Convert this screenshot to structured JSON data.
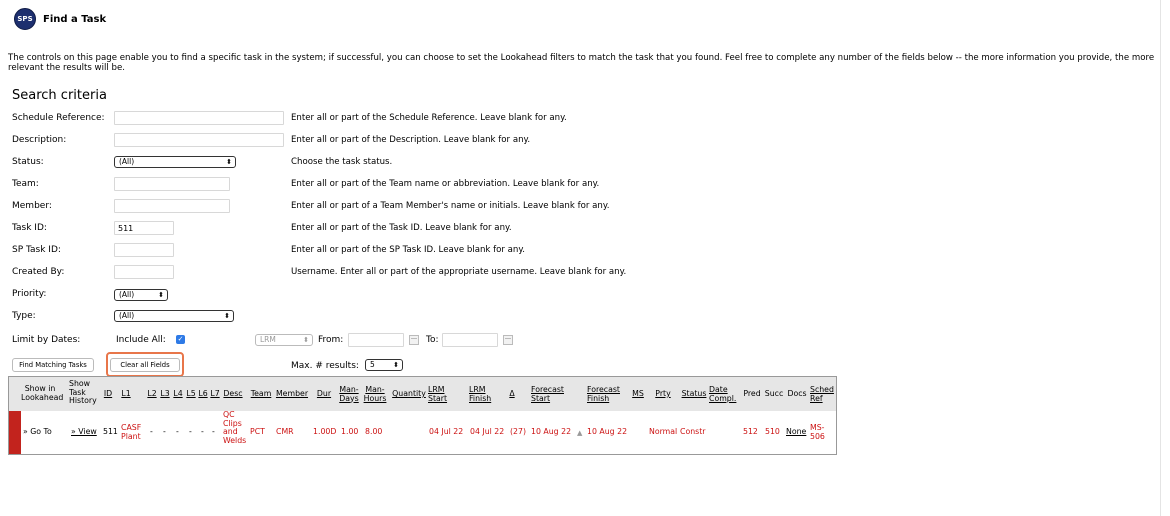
{
  "header": {
    "logo_text": "SPS",
    "title": "Find a Task"
  },
  "intro": "The controls on this page enable you to find a specific task in the system; if successful, you can choose to set the Lookahead filters to match the task that you found. Feel free to complete any number of the fields below -- the more information you provide, the more relevant the results will be.",
  "section_title": "Search criteria",
  "fields": {
    "schedule_reference": {
      "label": "Schedule Reference:",
      "value": "",
      "help": "Enter all or part of the Schedule Reference. Leave blank for any."
    },
    "description": {
      "label": "Description:",
      "value": "",
      "help": "Enter all or part of the Description. Leave blank for any."
    },
    "status": {
      "label": "Status:",
      "value": "(All)",
      "help": "Choose the task status."
    },
    "team": {
      "label": "Team:",
      "value": "",
      "help": "Enter all or part of the Team name or abbreviation. Leave blank for any."
    },
    "member": {
      "label": "Member:",
      "value": "",
      "help": "Enter all or part of a Team Member's name or initials. Leave blank for any."
    },
    "task_id": {
      "label": "Task ID:",
      "value": "511",
      "help": "Enter all or part of the Task ID. Leave blank for any."
    },
    "sp_task_id": {
      "label": "SP Task ID:",
      "value": "",
      "help": "Enter all or part of the SP Task ID. Leave blank for any."
    },
    "created_by": {
      "label": "Created By:",
      "value": "",
      "help": "Username. Enter all or part of the appropriate username. Leave blank for any."
    },
    "priority": {
      "label": "Priority:",
      "value": "(All)"
    },
    "type": {
      "label": "Type:",
      "value": "(All)"
    }
  },
  "dates": {
    "label": "Limit by Dates:",
    "include_all_label": "Include All:",
    "include_all_checked": true,
    "date_type": "LRM",
    "from_label": "From:",
    "from_value": "",
    "to_label": "To:",
    "to_value": ""
  },
  "actions": {
    "find_label": "Find Matching Tasks",
    "clear_label": "Clear all Fields",
    "max_results_label": "Max. # results:",
    "max_results_value": "5"
  },
  "table": {
    "headers": {
      "show_in_lookahead": "Show in Lookahead",
      "show_task_history": "Show Task History",
      "id": "ID",
      "l1": "L1",
      "l2": "L2",
      "l3": "L3",
      "l4": "L4",
      "l5": "L5",
      "l6": "L6",
      "l7": "L7",
      "desc": "Desc",
      "team": "Team",
      "member": "Member",
      "dur": "Dur",
      "man_days": "Man-Days",
      "man_hours": "Man-Hours",
      "quantity": "Quantity",
      "lrm_start": "LRM Start",
      "lrm_finish": "LRM Finish",
      "delta": "Δ",
      "forecast_start": "Forecast Start",
      "forecast_finish": "Forecast Finish",
      "ms": "MS",
      "prty": "Prty",
      "status": "Status",
      "date_compl": "Date Compl.",
      "pred": "Pred",
      "succ": "Succ",
      "docs": "Docs",
      "sched_ref": "Sched Ref"
    },
    "row": {
      "lookahead_link": "» Go To",
      "history_link": "» View",
      "id": "511",
      "l1": "CASF Plant",
      "l2": "-",
      "l3": "-",
      "l4": "-",
      "l5": "-",
      "l6": "-",
      "l7": "-",
      "desc": "QC Clips and Welds",
      "team": "PCT",
      "member": "CMR",
      "dur": "1.00D",
      "man_days": "1.00",
      "man_hours": "8.00",
      "quantity": "",
      "lrm_start": "04 Jul 22",
      "lrm_finish": "04 Jul 22",
      "delta": "(27)",
      "forecast_start": "10 Aug 22",
      "forecast_finish": "10 Aug 22",
      "ms": "",
      "prty": "Normal",
      "status": "Constr",
      "date_compl": "",
      "pred": "512",
      "succ": "510",
      "docs": "None",
      "sched_ref": "MS-506"
    }
  }
}
